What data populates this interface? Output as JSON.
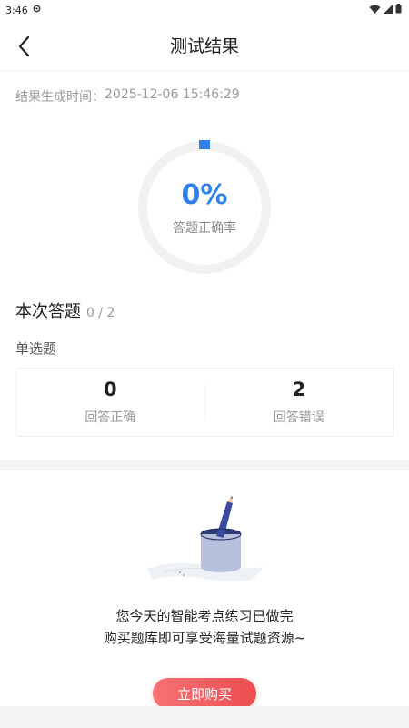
{
  "status_bar": {
    "time": "3:46",
    "battery_icon": "battery-icon"
  },
  "header": {
    "title": "测试结果",
    "back_icon": "back-arrow-icon"
  },
  "timestamp": {
    "label": "结果生成时间：",
    "value": "2025-12-06 15:46:29"
  },
  "gauge": {
    "value_text": "0%",
    "label": "答题正确率",
    "fraction": 0.0,
    "accent": "#2f80e8"
  },
  "section": {
    "title": "本次答题",
    "progress": "0 / 2"
  },
  "question_type": "单选题",
  "stats": [
    {
      "value": "0",
      "label": "回答正确"
    },
    {
      "value": "2",
      "label": "回答错误"
    }
  ],
  "promo": {
    "line1": "您今天的智能考点练习已做完",
    "line2": "购买题库即可享受海量试题资源~",
    "button": "立即购买",
    "button_color": "#ee4d50"
  }
}
